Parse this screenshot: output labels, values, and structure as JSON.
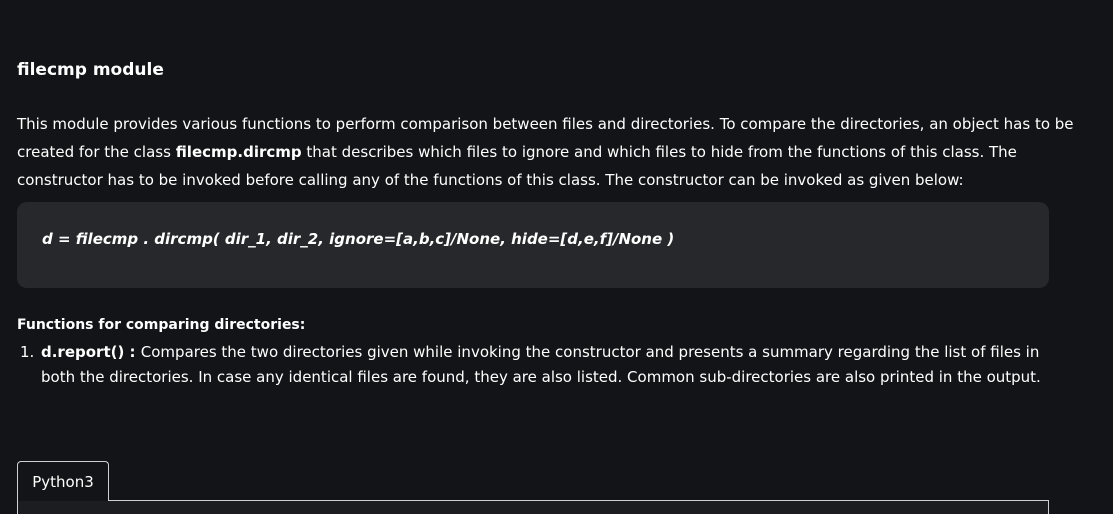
{
  "article": {
    "heading": "filecmp module",
    "intro": {
      "part1": "This module provides various functions to perform comparison between files and directories. To compare the directories, an object has to be created for the class ",
      "class_name": "filecmp.dircmp",
      "part2": " that describes which files to ignore and which files to hide from the functions of this class. The constructor has to be invoked before calling any of the functions of this class. The constructor can be invoked as given below:"
    },
    "code_snippet": "d = filecmp . dircmp( dir_1, dir_2, ignore=[a,b,c]/None, hide=[d,e,f]/None )",
    "functions_heading": "Functions for comparing directories:",
    "functions": [
      {
        "number": "1.",
        "name": "d.report()",
        "separator": " : ",
        "description": "Compares the two directories given while invoking the constructor and presents a summary regarding the list of files in both the directories. In case any identical files are found, they are also listed. Common sub-directories are also printed in the output."
      }
    ]
  },
  "code_tabs": {
    "active_tab": "Python3"
  },
  "colors": {
    "background": "#131417",
    "code_box": "#27282b",
    "text": "#ffffff",
    "tab_border": "#d0d0d0"
  }
}
